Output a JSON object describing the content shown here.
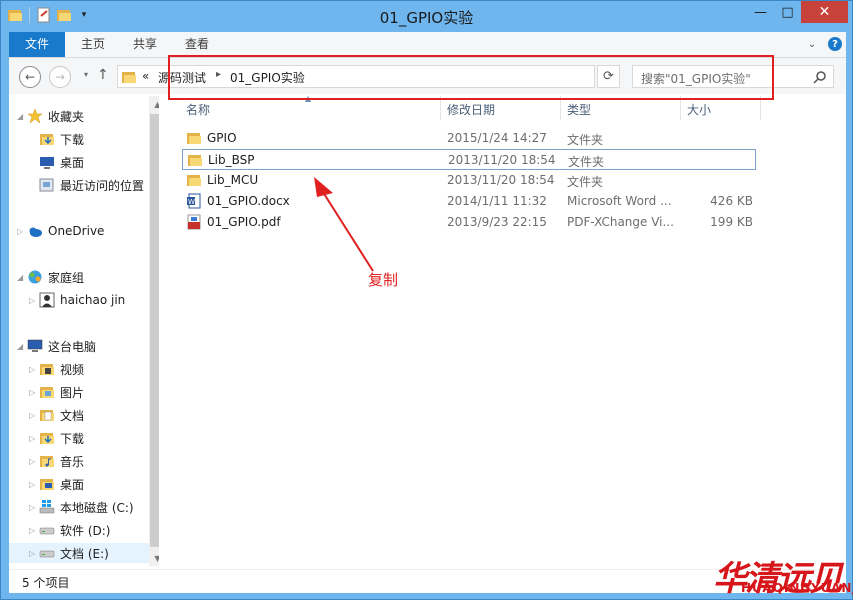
{
  "window": {
    "title": "01_GPIO实验",
    "minimize": "—",
    "maximize": "□",
    "close": "✕"
  },
  "ribbon": {
    "tabs": [
      "文件",
      "主页",
      "共享",
      "查看"
    ],
    "help": "?"
  },
  "nav": {
    "back": "←",
    "forward": "→",
    "up": "↑",
    "address": {
      "overflow": "«",
      "crumbs": [
        "源码测试",
        "01_GPIO实验"
      ],
      "separator": "▸"
    },
    "search_placeholder": "搜索\"01_GPIO实验\""
  },
  "sidebar": {
    "items": [
      {
        "label": "收藏夹",
        "icon": "star-icon",
        "level": 0
      },
      {
        "label": "下载",
        "icon": "downloads-folder-icon",
        "level": 1
      },
      {
        "label": "桌面",
        "icon": "desktop-icon",
        "level": 1
      },
      {
        "label": "最近访问的位置",
        "icon": "recent-places-icon",
        "level": 1
      },
      {
        "label": "OneDrive",
        "icon": "cloud-icon",
        "level": 0
      },
      {
        "label": "家庭组",
        "icon": "homegroup-icon",
        "level": 0
      },
      {
        "label": "haichao jin",
        "icon": "user-icon",
        "level": 1
      },
      {
        "label": "这台电脑",
        "icon": "computer-icon",
        "level": 0
      },
      {
        "label": "视频",
        "icon": "videos-folder-icon",
        "level": 1
      },
      {
        "label": "图片",
        "icon": "pictures-folder-icon",
        "level": 1
      },
      {
        "label": "文档",
        "icon": "documents-folder-icon",
        "level": 1
      },
      {
        "label": "下载",
        "icon": "downloads-folder-icon",
        "level": 1
      },
      {
        "label": "音乐",
        "icon": "music-folder-icon",
        "level": 1
      },
      {
        "label": "桌面",
        "icon": "desktop-folder-icon",
        "level": 1
      },
      {
        "label": "本地磁盘 (C:)",
        "icon": "windows-drive-icon",
        "level": 1
      },
      {
        "label": "软件 (D:)",
        "icon": "drive-icon",
        "level": 1
      },
      {
        "label": "文档 (E:)",
        "icon": "drive-icon",
        "level": 1
      }
    ]
  },
  "columns": {
    "name": "名称",
    "date": "修改日期",
    "type": "类型",
    "size": "大小"
  },
  "files": [
    {
      "name": "GPIO",
      "date": "2015/1/24 14:27",
      "type": "文件夹",
      "size": "",
      "icon": "folder-icon"
    },
    {
      "name": "Lib_BSP",
      "date": "2013/11/20 18:54",
      "type": "文件夹",
      "size": "",
      "icon": "folder-icon"
    },
    {
      "name": "Lib_MCU",
      "date": "2013/11/20 18:54",
      "type": "文件夹",
      "size": "",
      "icon": "folder-icon"
    },
    {
      "name": "01_GPIO.docx",
      "date": "2014/1/11 11:32",
      "type": "Microsoft Word ...",
      "size": "426 KB",
      "icon": "word-doc-icon"
    },
    {
      "name": "01_GPIO.pdf",
      "date": "2013/9/23 22:15",
      "type": "PDF-XChange Vi...",
      "size": "199 KB",
      "icon": "pdf-icon"
    }
  ],
  "annotation": {
    "label": "复制",
    "color": "#e02020"
  },
  "status": {
    "item_count": "5 个项目"
  },
  "watermark": {
    "text": "华清远见",
    "sub": "HUAQINGYUANJIAN"
  },
  "colors": {
    "titlebar": "#6fb6ee",
    "file_tab": "#1979ca",
    "close": "#c7423a",
    "folder": "#f8d775"
  }
}
